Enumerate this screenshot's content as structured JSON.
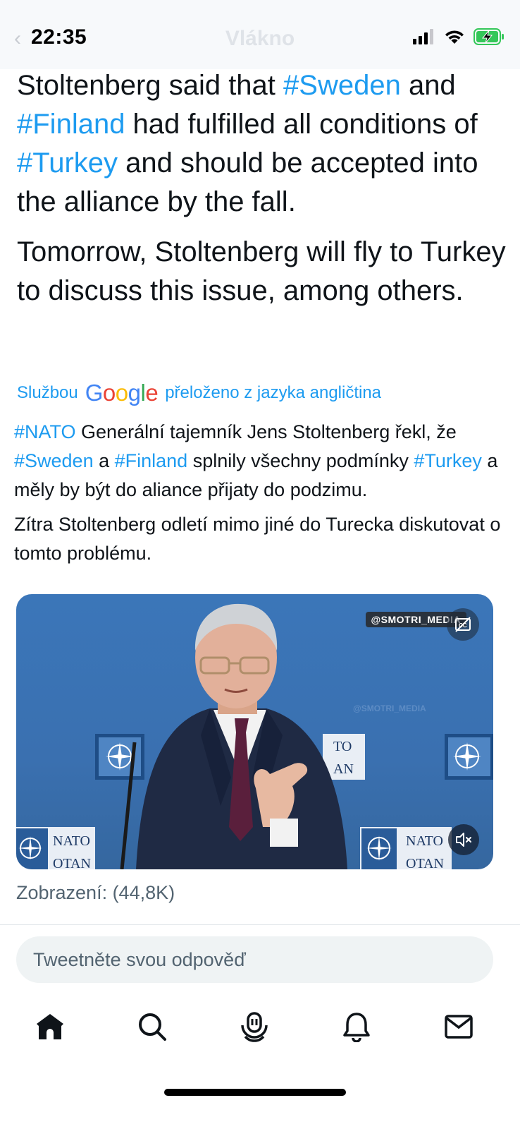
{
  "status_bar": {
    "time": "22:35"
  },
  "nav": {
    "title": "Vlákno"
  },
  "tweet": {
    "en_paragraph_1": [
      {
        "text": "Stoltenberg said that ",
        "tag": false
      },
      {
        "text": "#Sweden",
        "tag": true
      },
      {
        "text": " and ",
        "tag": false
      },
      {
        "text": "#Finland",
        "tag": true
      },
      {
        "text": " had fulfilled all conditions of ",
        "tag": false
      },
      {
        "text": "#Turkey",
        "tag": true
      },
      {
        "text": " and should be accepted into the alliance by the fall.",
        "tag": false
      }
    ],
    "en_paragraph_2": "Tomorrow, Stoltenberg will fly to Turkey to discuss this issue, among others.",
    "translated_by_prefix": "Službou",
    "translated_by_brand": "Google",
    "translated_by_suffix": "přeloženo z jazyka angličtina",
    "cs_paragraph_1": [
      {
        "text": "#NATO",
        "tag": true
      },
      {
        "text": " Generální tajemník Jens Stoltenberg řekl, že ",
        "tag": false
      },
      {
        "text": "#Sweden",
        "tag": true
      },
      {
        "text": " a ",
        "tag": false
      },
      {
        "text": "#Finland",
        "tag": true
      },
      {
        "text": " splnily všechny podmínky ",
        "tag": false
      },
      {
        "text": "#Turkey",
        "tag": true
      },
      {
        "text": " a měly by být do aliance přijaty do podzimu.",
        "tag": false
      }
    ],
    "cs_paragraph_2": "Zítra Stoltenberg odletí mimo jiné do Turecka diskutovat o tomto problému."
  },
  "video": {
    "watermark": "@SMOTRI_MEDIA",
    "watermark_faint": "@SMOTRI_MEDIA",
    "sign_left_line1": "NATO",
    "sign_left_line2": "OTAN",
    "sign_mid_line1": "TO",
    "sign_mid_line2": "AN",
    "sign_right_line1": "NATO",
    "sign_right_line2": "OTAN"
  },
  "views": "Zobrazení: (44,8K)",
  "reply": {
    "placeholder": "Tweetněte svou odpověď"
  },
  "tabbar": {
    "icons": [
      "home-icon",
      "search-icon",
      "spaces-icon",
      "notifications-icon",
      "messages-icon"
    ]
  },
  "colors": {
    "link": "#1d9bf0",
    "text": "#0f1419",
    "muted": "#536471"
  }
}
